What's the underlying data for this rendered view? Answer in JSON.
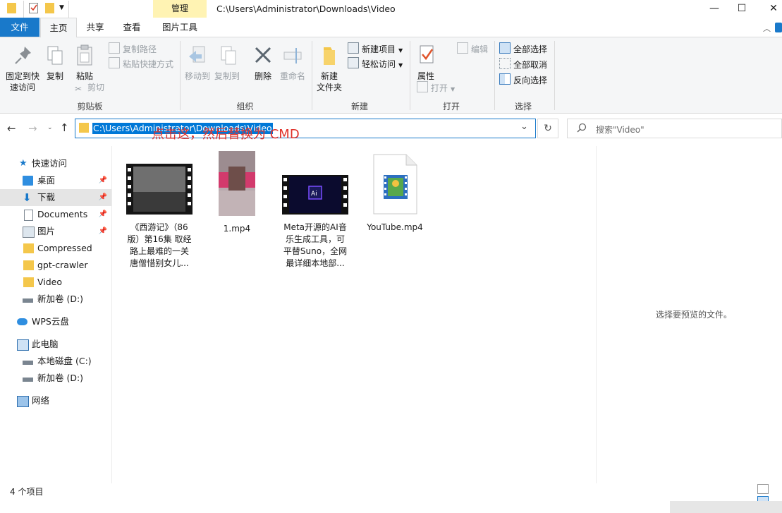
{
  "window": {
    "contextual_tab": "管理",
    "title_path": "C:\\Users\\Administrator\\Downloads\\Video",
    "minimize_glyph": "—",
    "maximize_glyph": "☐",
    "close_glyph": "✕"
  },
  "tabs": [
    {
      "label": "文件"
    },
    {
      "label": "主页"
    },
    {
      "label": "共享"
    },
    {
      "label": "查看"
    },
    {
      "label": "图片工具"
    }
  ],
  "ribbon": {
    "clipboard": {
      "pin_label": "固定到快\n速访问",
      "copy_label": "复制",
      "paste_label": "粘贴",
      "copy_path_label": "复制路径",
      "paste_shortcut_label": "粘贴快捷方式",
      "cut_label": "剪切",
      "group_label": "剪贴板"
    },
    "organize": {
      "move_to_label": "移动到",
      "copy_to_label": "复制到",
      "delete_label": "删除",
      "rename_label": "重命名",
      "group_label": "组织"
    },
    "new": {
      "new_folder_label": "新建\n文件夹",
      "new_item_label": "新建项目",
      "easy_access_label": "轻松访问",
      "group_label": "新建"
    },
    "open": {
      "properties_label": "属性",
      "open_label": "打开",
      "edit_label": "编辑",
      "group_label": "打开"
    },
    "select": {
      "select_all_label": "全部选择",
      "select_none_label": "全部取消",
      "invert_label": "反向选择",
      "group_label": "选择"
    }
  },
  "address_bar": {
    "path": "C:\\Users\\Administrator\\Downloads\\Video",
    "annotation": "点击这，然后替换为 CMD",
    "search_placeholder": "搜索\"Video\""
  },
  "nav_pane": {
    "items": [
      {
        "label": "快速访问",
        "icon": "star-icon"
      },
      {
        "label": "桌面",
        "icon": "desktop-icon",
        "pinned": true
      },
      {
        "label": "下载",
        "icon": "download-icon",
        "pinned": true
      },
      {
        "label": "Documents",
        "icon": "document-icon",
        "pinned": true
      },
      {
        "label": "图片",
        "icon": "picture-icon",
        "pinned": true
      },
      {
        "label": "Compressed",
        "icon": "folder-icon"
      },
      {
        "label": "gpt-crawler",
        "icon": "folder-icon"
      },
      {
        "label": "Video",
        "icon": "folder-icon"
      },
      {
        "label": "新加卷 (D:)",
        "icon": "drive-icon"
      },
      {
        "label": "WPS云盘",
        "icon": "cloud-icon"
      },
      {
        "label": "此电脑",
        "icon": "computer-icon"
      },
      {
        "label": "本地磁盘 (C:)",
        "icon": "drive-icon"
      },
      {
        "label": "新加卷 (D:)",
        "icon": "drive-icon"
      },
      {
        "label": "网络",
        "icon": "network-icon"
      }
    ]
  },
  "files": [
    {
      "name_lines": [
        "《西游记》（86",
        "版）第16集 取经",
        "路上最难的一关",
        "唐僧惜别女儿..."
      ]
    },
    {
      "name_lines": [
        "1.mp4"
      ]
    },
    {
      "name_lines": [
        "Meta开源的AI音",
        "乐生成工具，可",
        "平替Suno，全网",
        "最详细本地部..."
      ]
    },
    {
      "name_lines": [
        "YouTube.mp4"
      ]
    }
  ],
  "preview": {
    "empty_text": "选择要预览的文件。"
  },
  "status": {
    "item_count": "4 个项目"
  },
  "colors": {
    "accent": "#1979ca",
    "manage_tab": "#fff3b3",
    "annotation": "#e0322b"
  }
}
